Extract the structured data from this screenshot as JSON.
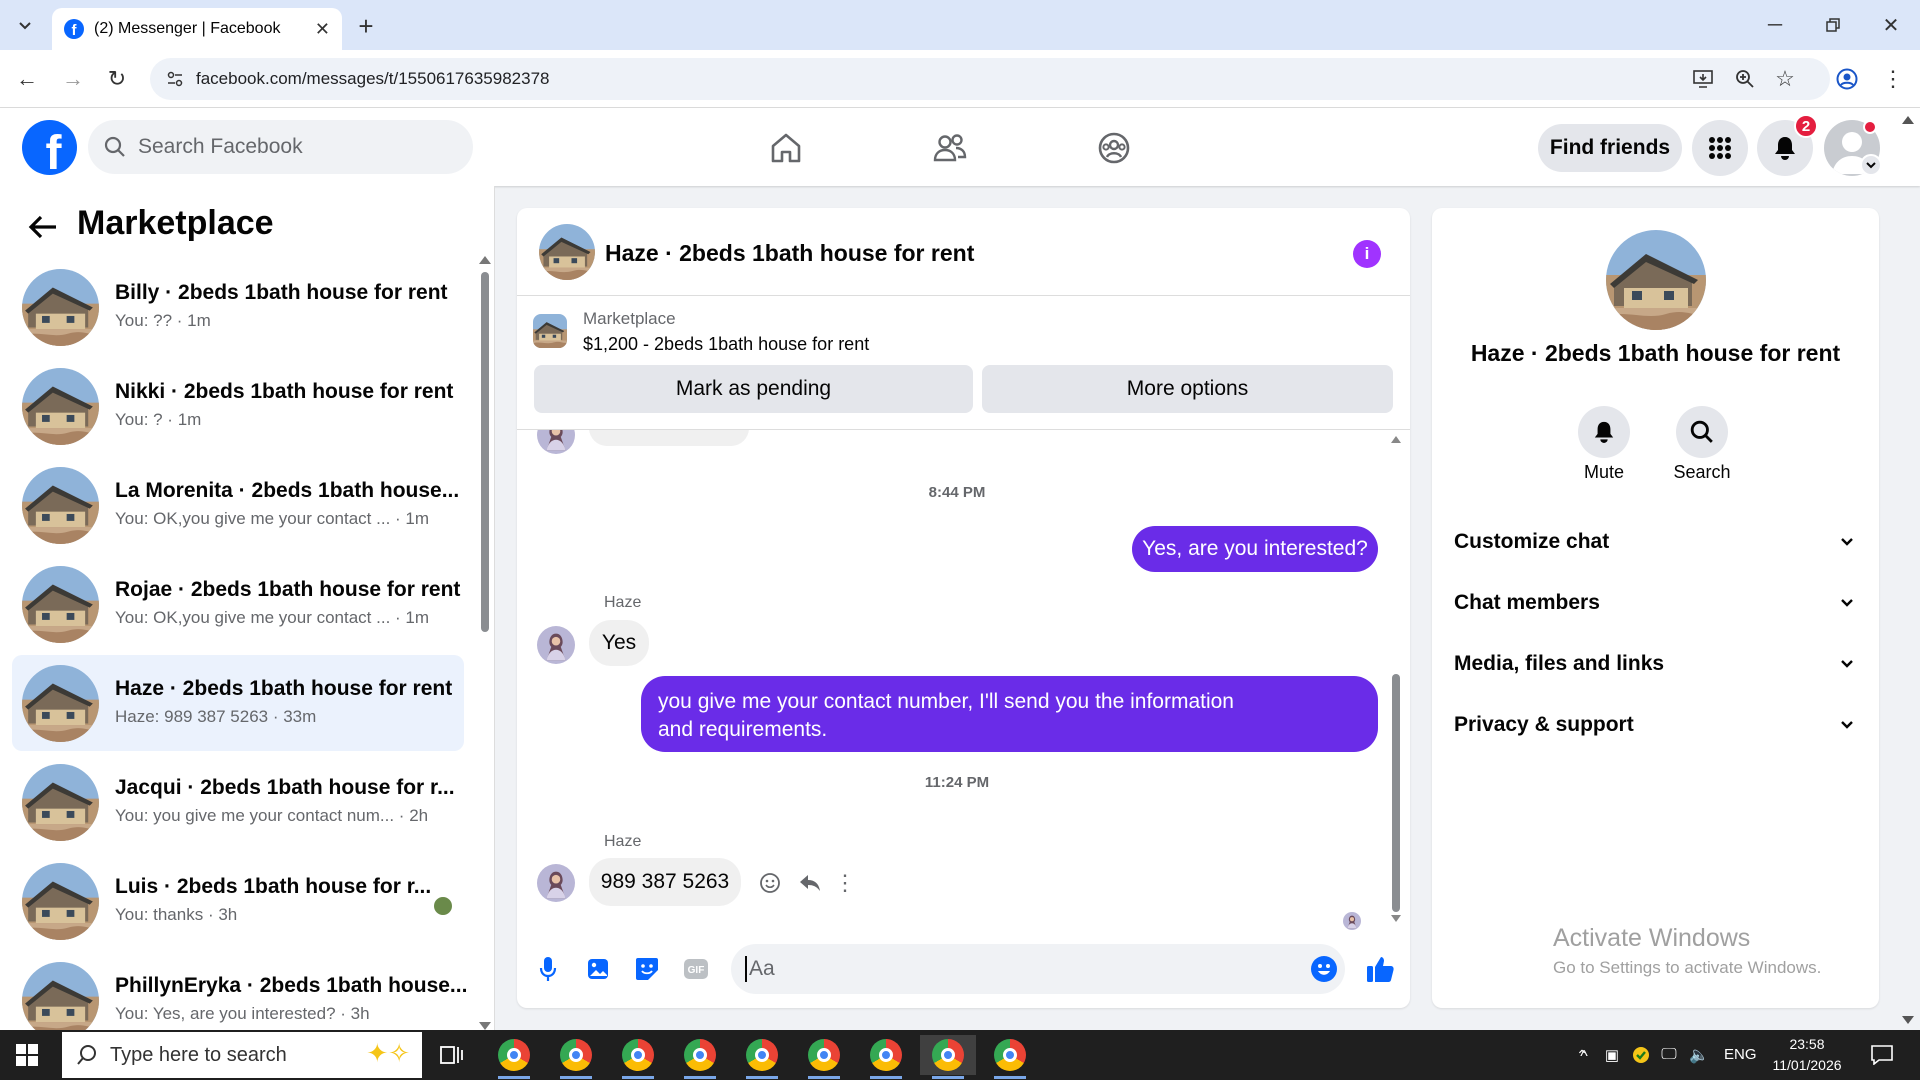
{
  "browser": {
    "tab_title": "(2) Messenger | Facebook",
    "url": "facebook.com/messages/t/1550617635982378"
  },
  "header": {
    "search_placeholder": "Search Facebook",
    "find_friends": "Find friends",
    "notification_count": "2"
  },
  "left": {
    "title": "Marketplace",
    "conversations": [
      {
        "name": "Billy · 2beds 1bath house for rent",
        "preview": "You: ?? · 1m"
      },
      {
        "name": "Nikki · 2beds 1bath house for rent",
        "preview": "You: ? · 1m"
      },
      {
        "name": "La Morenita · 2beds 1bath house...",
        "preview": "You: OK,you give me your contact ... · 1m"
      },
      {
        "name": "Rojae · 2beds 1bath house for rent",
        "preview": "You: OK,you give me your contact ... · 1m"
      },
      {
        "name": "Haze · 2beds 1bath house for rent",
        "preview": "Haze: 989 387 5263 · 33m"
      },
      {
        "name": "Jacqui · 2beds 1bath house for r...",
        "preview": "You: you give me your contact num... · 2h"
      },
      {
        "name": "Luis · 2beds 1bath house for r...",
        "preview": "You: thanks · 3h"
      },
      {
        "name": "PhillynEryka · 2beds 1bath house...",
        "preview": "You: Yes, are you interested? · 3h"
      }
    ]
  },
  "chat": {
    "title": "Haze · 2beds 1bath house for rent",
    "listing_source": "Marketplace",
    "listing_title": "$1,200 - 2beds 1bath house for rent",
    "mark_pending": "Mark as pending",
    "more_options": "More options",
    "time1": "8:44 PM",
    "msg_out_1": "Yes, are you interested?",
    "sender_1": "Haze",
    "msg_in_1": "Yes",
    "msg_out_2_line1": "you give me your contact number, I'll send you the information",
    "msg_out_2_line2": "and requirements.",
    "time2": "11:24 PM",
    "sender_2": "Haze",
    "msg_in_2": "989 387 5263",
    "composer_placeholder": "Aa"
  },
  "details": {
    "name": "Haze · 2beds 1bath house for rent",
    "mute": "Mute",
    "search": "Search",
    "sections": [
      "Customize chat",
      "Chat members",
      "Media, files and links",
      "Privacy & support"
    ],
    "watermark_title": "Activate Windows",
    "watermark_sub": "Go to Settings to activate Windows."
  },
  "taskbar": {
    "search_placeholder": "Type here to search",
    "lang": "ENG",
    "time": "23:58",
    "date": "11/01/2026"
  },
  "colors": {
    "fb_blue": "#0866ff",
    "outgoing_bubble": "#6a2ce8",
    "active_item": "#ebf2fd",
    "badge_red": "#e41e3f"
  }
}
